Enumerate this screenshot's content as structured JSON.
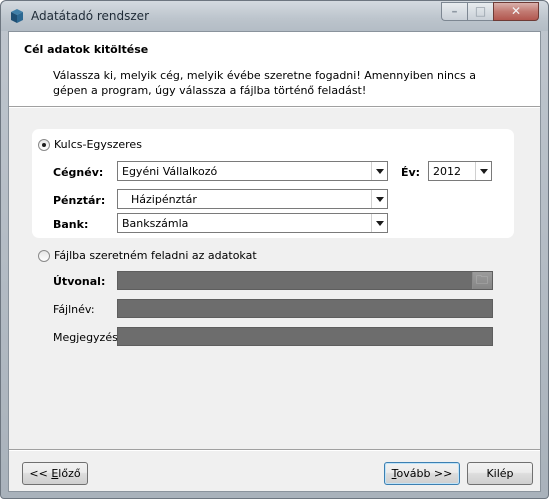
{
  "window": {
    "title": "Adatátadó rendszer",
    "controls": {
      "minimize": "–",
      "maximize": "□",
      "close": "✕"
    }
  },
  "header": {
    "title": "Cél adatok kitöltése",
    "description": "Válassza ki, melyik cég, melyik évébe szeretne fogadni! Amennyiben nincs a gépen a program, úgy válassza a fájlba történő feladást!"
  },
  "option_local": {
    "label": "Kulcs-Egyszeres",
    "selected": true,
    "fields": {
      "company_label": "Cégnév:",
      "company_value": "Egyéni Vállalkozó",
      "year_label": "Év:",
      "year_value": "2012",
      "cash_label": "Pénztár:",
      "cash_value": "Házipénztár",
      "bank_label": "Bank:",
      "bank_value": "Bankszámla"
    }
  },
  "option_file": {
    "label": "Fájlba szeretném feladni az adatokat",
    "selected": false,
    "fields": {
      "path_label": "Útvonal:",
      "path_value": "",
      "filename_label": "Fájlnév:",
      "filename_value": "",
      "note_label": "Megjegyzés:",
      "note_value": ""
    }
  },
  "footer": {
    "back_prefix": "<< ",
    "back_key": "E",
    "back_rest": "lőző",
    "next_key": "T",
    "next_rest": "ovább >>",
    "exit_label": "Kilép"
  },
  "colors": {
    "titlebar": "#bcc4cc",
    "close_button": "#c27a72",
    "panel_bg": "#ffffff",
    "dialog_bg": "#f0f0f0",
    "disabled_field": "#6d6d6d"
  },
  "icons": {
    "app": "app-cube-icon",
    "browse": "folder-browse-icon",
    "dropdown": "chevron-down-icon"
  }
}
